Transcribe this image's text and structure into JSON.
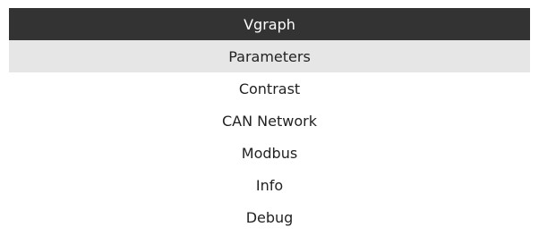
{
  "window": {
    "title": "Vgraph"
  },
  "menu": {
    "items": [
      {
        "label": "Parameters",
        "selected": true
      },
      {
        "label": "Contrast",
        "selected": false
      },
      {
        "label": "CAN Network",
        "selected": false
      },
      {
        "label": "Modbus",
        "selected": false
      },
      {
        "label": "Info",
        "selected": false
      },
      {
        "label": "Debug",
        "selected": false
      }
    ]
  },
  "colors": {
    "title_bg": "#333333",
    "title_text": "#ffffff",
    "selected_bg": "#e6e6e6",
    "text": "#222222"
  }
}
